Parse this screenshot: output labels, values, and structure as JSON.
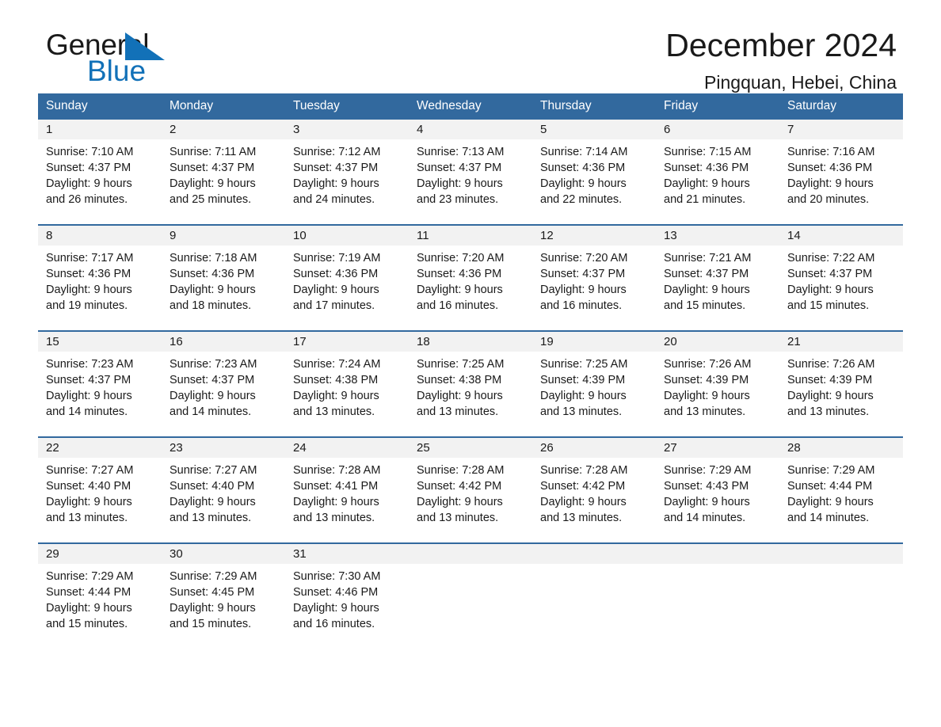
{
  "brand": {
    "name_dark": "General",
    "name_blue": "Blue",
    "triangle_color": "#1271b8"
  },
  "header": {
    "title": "December 2024",
    "location": "Pingquan, Hebei, China"
  },
  "colors": {
    "header_blue": "#32699e",
    "day_band": "#f2f2f2",
    "text": "#1a1a1a"
  },
  "calendar": {
    "day_names": [
      "Sunday",
      "Monday",
      "Tuesday",
      "Wednesday",
      "Thursday",
      "Friday",
      "Saturday"
    ],
    "weeks": [
      [
        {
          "day": "1",
          "sunrise": "Sunrise: 7:10 AM",
          "sunset": "Sunset: 4:37 PM",
          "daylight1": "Daylight: 9 hours",
          "daylight2": "and 26 minutes."
        },
        {
          "day": "2",
          "sunrise": "Sunrise: 7:11 AM",
          "sunset": "Sunset: 4:37 PM",
          "daylight1": "Daylight: 9 hours",
          "daylight2": "and 25 minutes."
        },
        {
          "day": "3",
          "sunrise": "Sunrise: 7:12 AM",
          "sunset": "Sunset: 4:37 PM",
          "daylight1": "Daylight: 9 hours",
          "daylight2": "and 24 minutes."
        },
        {
          "day": "4",
          "sunrise": "Sunrise: 7:13 AM",
          "sunset": "Sunset: 4:37 PM",
          "daylight1": "Daylight: 9 hours",
          "daylight2": "and 23 minutes."
        },
        {
          "day": "5",
          "sunrise": "Sunrise: 7:14 AM",
          "sunset": "Sunset: 4:36 PM",
          "daylight1": "Daylight: 9 hours",
          "daylight2": "and 22 minutes."
        },
        {
          "day": "6",
          "sunrise": "Sunrise: 7:15 AM",
          "sunset": "Sunset: 4:36 PM",
          "daylight1": "Daylight: 9 hours",
          "daylight2": "and 21 minutes."
        },
        {
          "day": "7",
          "sunrise": "Sunrise: 7:16 AM",
          "sunset": "Sunset: 4:36 PM",
          "daylight1": "Daylight: 9 hours",
          "daylight2": "and 20 minutes."
        }
      ],
      [
        {
          "day": "8",
          "sunrise": "Sunrise: 7:17 AM",
          "sunset": "Sunset: 4:36 PM",
          "daylight1": "Daylight: 9 hours",
          "daylight2": "and 19 minutes."
        },
        {
          "day": "9",
          "sunrise": "Sunrise: 7:18 AM",
          "sunset": "Sunset: 4:36 PM",
          "daylight1": "Daylight: 9 hours",
          "daylight2": "and 18 minutes."
        },
        {
          "day": "10",
          "sunrise": "Sunrise: 7:19 AM",
          "sunset": "Sunset: 4:36 PM",
          "daylight1": "Daylight: 9 hours",
          "daylight2": "and 17 minutes."
        },
        {
          "day": "11",
          "sunrise": "Sunrise: 7:20 AM",
          "sunset": "Sunset: 4:36 PM",
          "daylight1": "Daylight: 9 hours",
          "daylight2": "and 16 minutes."
        },
        {
          "day": "12",
          "sunrise": "Sunrise: 7:20 AM",
          "sunset": "Sunset: 4:37 PM",
          "daylight1": "Daylight: 9 hours",
          "daylight2": "and 16 minutes."
        },
        {
          "day": "13",
          "sunrise": "Sunrise: 7:21 AM",
          "sunset": "Sunset: 4:37 PM",
          "daylight1": "Daylight: 9 hours",
          "daylight2": "and 15 minutes."
        },
        {
          "day": "14",
          "sunrise": "Sunrise: 7:22 AM",
          "sunset": "Sunset: 4:37 PM",
          "daylight1": "Daylight: 9 hours",
          "daylight2": "and 15 minutes."
        }
      ],
      [
        {
          "day": "15",
          "sunrise": "Sunrise: 7:23 AM",
          "sunset": "Sunset: 4:37 PM",
          "daylight1": "Daylight: 9 hours",
          "daylight2": "and 14 minutes."
        },
        {
          "day": "16",
          "sunrise": "Sunrise: 7:23 AM",
          "sunset": "Sunset: 4:37 PM",
          "daylight1": "Daylight: 9 hours",
          "daylight2": "and 14 minutes."
        },
        {
          "day": "17",
          "sunrise": "Sunrise: 7:24 AM",
          "sunset": "Sunset: 4:38 PM",
          "daylight1": "Daylight: 9 hours",
          "daylight2": "and 13 minutes."
        },
        {
          "day": "18",
          "sunrise": "Sunrise: 7:25 AM",
          "sunset": "Sunset: 4:38 PM",
          "daylight1": "Daylight: 9 hours",
          "daylight2": "and 13 minutes."
        },
        {
          "day": "19",
          "sunrise": "Sunrise: 7:25 AM",
          "sunset": "Sunset: 4:39 PM",
          "daylight1": "Daylight: 9 hours",
          "daylight2": "and 13 minutes."
        },
        {
          "day": "20",
          "sunrise": "Sunrise: 7:26 AM",
          "sunset": "Sunset: 4:39 PM",
          "daylight1": "Daylight: 9 hours",
          "daylight2": "and 13 minutes."
        },
        {
          "day": "21",
          "sunrise": "Sunrise: 7:26 AM",
          "sunset": "Sunset: 4:39 PM",
          "daylight1": "Daylight: 9 hours",
          "daylight2": "and 13 minutes."
        }
      ],
      [
        {
          "day": "22",
          "sunrise": "Sunrise: 7:27 AM",
          "sunset": "Sunset: 4:40 PM",
          "daylight1": "Daylight: 9 hours",
          "daylight2": "and 13 minutes."
        },
        {
          "day": "23",
          "sunrise": "Sunrise: 7:27 AM",
          "sunset": "Sunset: 4:40 PM",
          "daylight1": "Daylight: 9 hours",
          "daylight2": "and 13 minutes."
        },
        {
          "day": "24",
          "sunrise": "Sunrise: 7:28 AM",
          "sunset": "Sunset: 4:41 PM",
          "daylight1": "Daylight: 9 hours",
          "daylight2": "and 13 minutes."
        },
        {
          "day": "25",
          "sunrise": "Sunrise: 7:28 AM",
          "sunset": "Sunset: 4:42 PM",
          "daylight1": "Daylight: 9 hours",
          "daylight2": "and 13 minutes."
        },
        {
          "day": "26",
          "sunrise": "Sunrise: 7:28 AM",
          "sunset": "Sunset: 4:42 PM",
          "daylight1": "Daylight: 9 hours",
          "daylight2": "and 13 minutes."
        },
        {
          "day": "27",
          "sunrise": "Sunrise: 7:29 AM",
          "sunset": "Sunset: 4:43 PM",
          "daylight1": "Daylight: 9 hours",
          "daylight2": "and 14 minutes."
        },
        {
          "day": "28",
          "sunrise": "Sunrise: 7:29 AM",
          "sunset": "Sunset: 4:44 PM",
          "daylight1": "Daylight: 9 hours",
          "daylight2": "and 14 minutes."
        }
      ],
      [
        {
          "day": "29",
          "sunrise": "Sunrise: 7:29 AM",
          "sunset": "Sunset: 4:44 PM",
          "daylight1": "Daylight: 9 hours",
          "daylight2": "and 15 minutes."
        },
        {
          "day": "30",
          "sunrise": "Sunrise: 7:29 AM",
          "sunset": "Sunset: 4:45 PM",
          "daylight1": "Daylight: 9 hours",
          "daylight2": "and 15 minutes."
        },
        {
          "day": "31",
          "sunrise": "Sunrise: 7:30 AM",
          "sunset": "Sunset: 4:46 PM",
          "daylight1": "Daylight: 9 hours",
          "daylight2": "and 16 minutes."
        },
        {
          "day": "",
          "sunrise": "",
          "sunset": "",
          "daylight1": "",
          "daylight2": ""
        },
        {
          "day": "",
          "sunrise": "",
          "sunset": "",
          "daylight1": "",
          "daylight2": ""
        },
        {
          "day": "",
          "sunrise": "",
          "sunset": "",
          "daylight1": "",
          "daylight2": ""
        },
        {
          "day": "",
          "sunrise": "",
          "sunset": "",
          "daylight1": "",
          "daylight2": ""
        }
      ]
    ]
  }
}
